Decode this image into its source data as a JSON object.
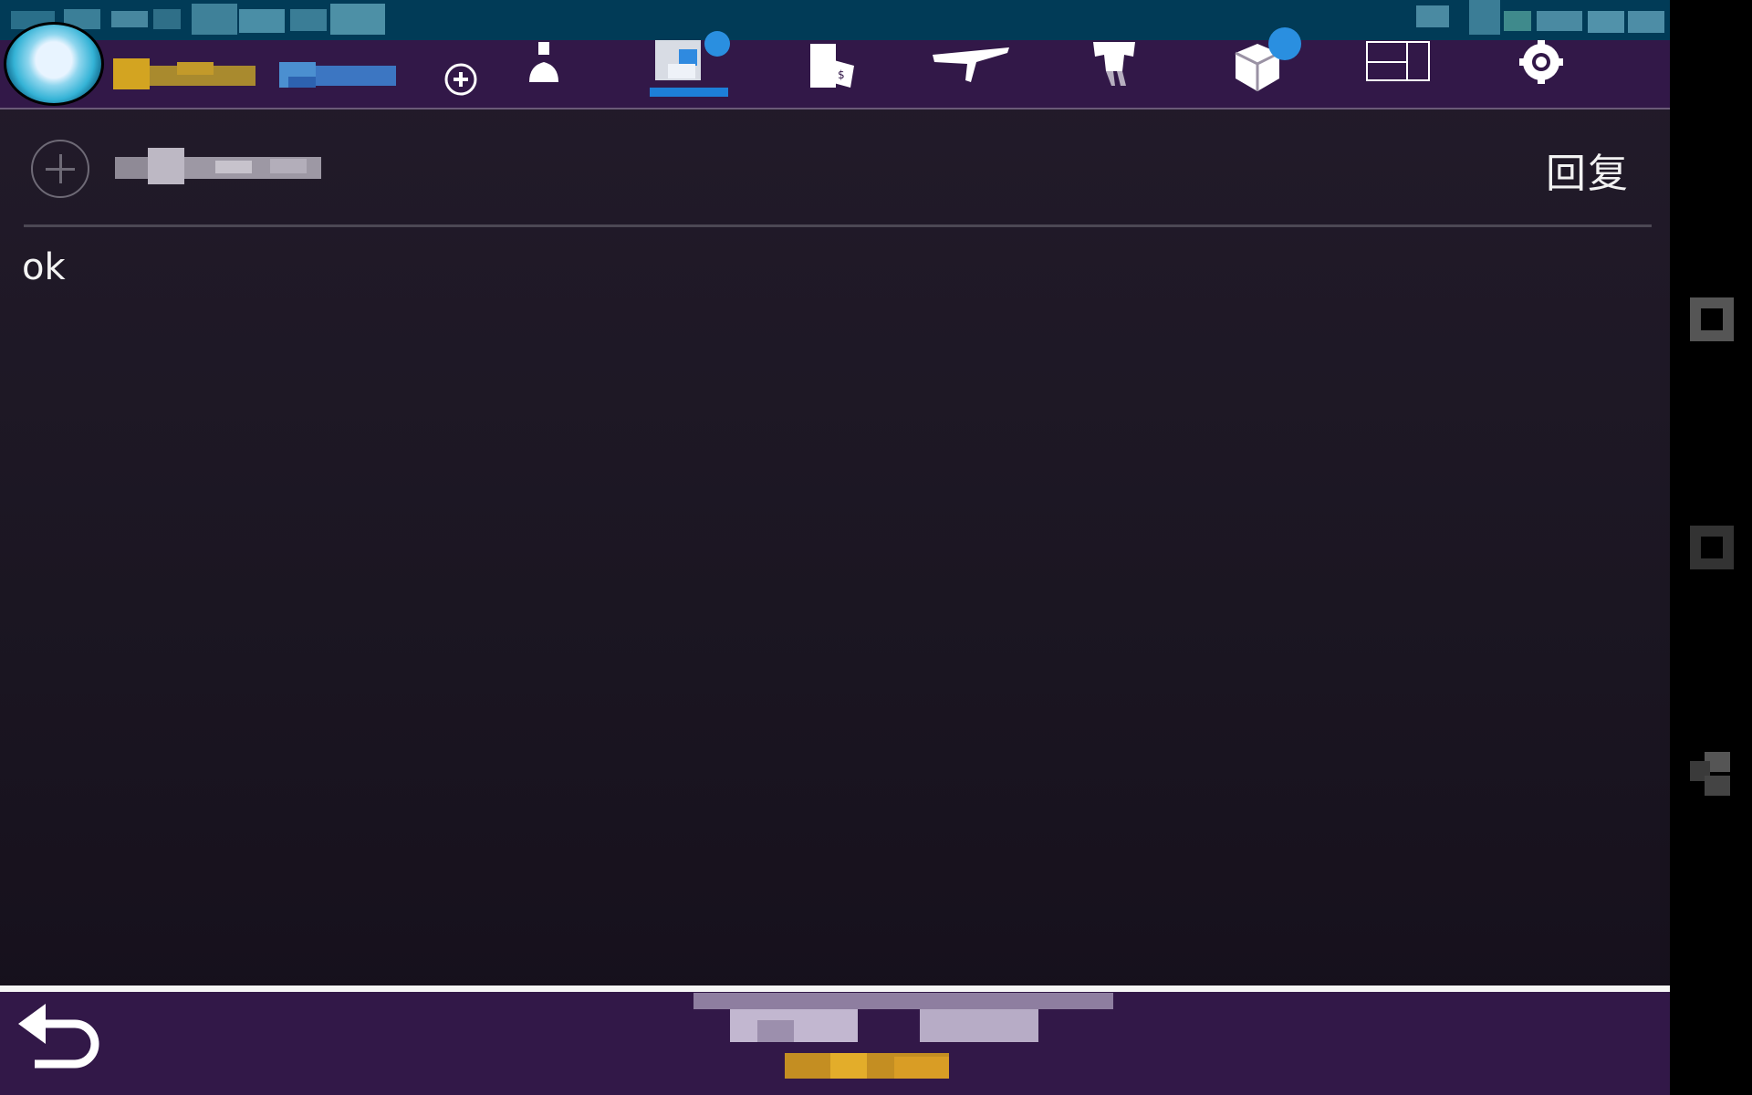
{
  "compose": {
    "reply_label": "回复"
  },
  "message": {
    "text": "ok"
  },
  "colors": {
    "top_bar": "#321848",
    "content_background": "#1d1724",
    "status_bar": "#013b57",
    "divider": "#4c4854",
    "active_tab_indicator": "#1e7fd8"
  },
  "icons": {
    "add": "add-circle-icon",
    "profile": "profile-icon",
    "messages": "messages-icon",
    "shop": "shop-bag-icon",
    "airplane": "airplane-icon",
    "outfit": "outfit-icon",
    "box": "box-icon",
    "layout": "layout-icon",
    "settings": "gear-icon",
    "back": "back-arrow-icon"
  }
}
